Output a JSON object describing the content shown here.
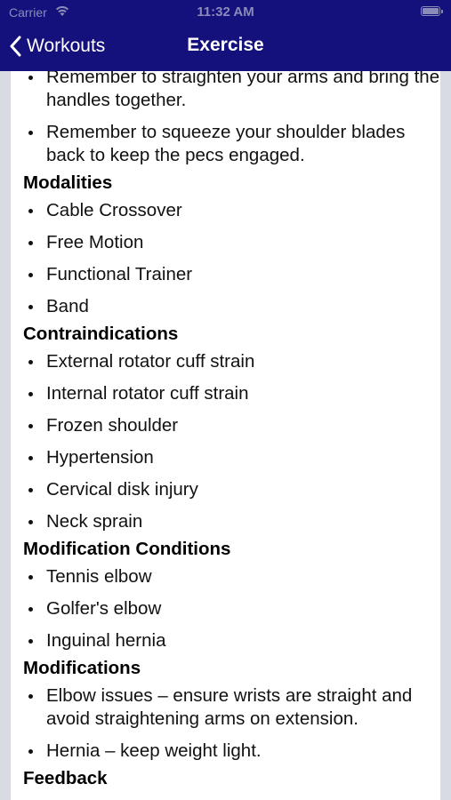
{
  "status_bar": {
    "carrier": "Carrier",
    "time": "11:32 AM"
  },
  "nav": {
    "back_label": "Workouts",
    "title": "Exercise"
  },
  "tips": [
    "Remember to straighten your arms and bring the handles together.",
    "Remember to squeeze your shoulder blades back to keep the pecs engaged."
  ],
  "modalities": {
    "heading": "Modalities",
    "items": [
      "Cable Crossover",
      "Free Motion",
      "Functional Trainer",
      "Band"
    ]
  },
  "contraindications": {
    "heading": "Contraindications",
    "items": [
      "External rotator cuff strain",
      "Internal rotator cuff strain",
      "Frozen shoulder",
      "Hypertension",
      "Cervical disk injury",
      "Neck sprain"
    ]
  },
  "modification_conditions": {
    "heading": "Modification Conditions",
    "items": [
      "Tennis elbow",
      "Golfer's elbow",
      "Inguinal hernia"
    ]
  },
  "modifications": {
    "heading": "Modifications",
    "items": [
      "Elbow issues – ensure wrists are straight and avoid straightening arms on extension.",
      "Hernia – keep weight light."
    ]
  },
  "feedback": {
    "heading": "Feedback"
  },
  "colors": {
    "nav_background": "#14117d",
    "page_background": "#d9dbe2",
    "content_background": "#ffffff"
  },
  "icons": {
    "wifi": "wifi-icon",
    "battery": "battery-icon",
    "back": "chevron-left-icon"
  }
}
